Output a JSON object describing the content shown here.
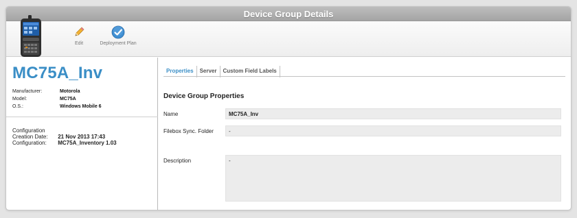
{
  "window": {
    "title": "Device Group Details"
  },
  "toolbar": {
    "edit_label": "Edit",
    "deployment_plan_label": "Deployment Plan",
    "icons": {
      "edit": "pencil-icon",
      "deploy": "checkmark-circle-icon",
      "device": "mobile-device-icon"
    },
    "accent": "#3a8ec6"
  },
  "device": {
    "name": "MC75A_Inv",
    "info": [
      {
        "label": "Manufacturer:",
        "value": "Motorola"
      },
      {
        "label": "Model:",
        "value": "MC75A"
      },
      {
        "label": "O.S.:",
        "value": "Windows Mobile 6"
      }
    ],
    "configuration": {
      "heading": "Configuration",
      "creation_label": "Creation Date:",
      "creation_value": "21 Nov 2013 17:43",
      "config_label": "Configuration:",
      "config_value": "MC75A_Inventory 1.03"
    }
  },
  "tabs": [
    {
      "label": "Properties",
      "active": true
    },
    {
      "label": "Server",
      "active": false
    },
    {
      "label": "Custom Field Labels",
      "active": false
    }
  ],
  "properties": {
    "section_title": "Device Group Properties",
    "name_label": "Name",
    "name_value": "MC75A_Inv",
    "filebox_label": "Filebox Sync. Folder",
    "filebox_value": "-",
    "description_label": "Description",
    "description_value": "-"
  }
}
